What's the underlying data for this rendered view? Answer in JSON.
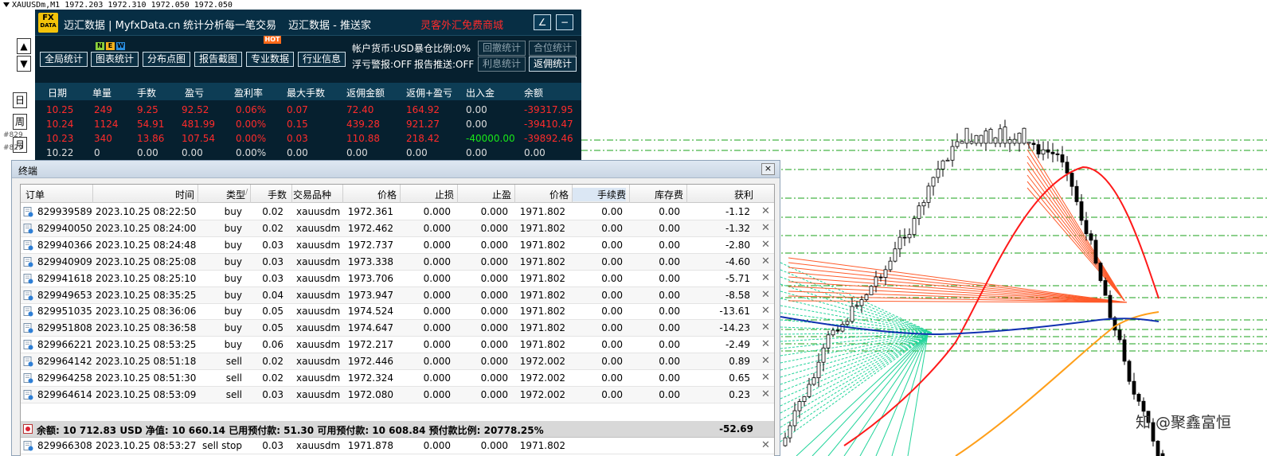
{
  "chart": {
    "header": "XAUUSDm,M1  1972.203 1972.310 1972.050 1972.050",
    "price_labels": [
      "#829",
      "#829"
    ],
    "colors": {
      "up_candle": "#ffffff",
      "down_candle": "#000000",
      "ma_red": "#ff1a1a",
      "ma_orange": "#ff9f1a",
      "ma_blue": "#1030b0",
      "levels_green": "#18a018",
      "fan_green": "#22d49a",
      "fan_red": "#ff5a2a"
    }
  },
  "stats": {
    "logo_top": "FX",
    "logo_bottom": "DATA",
    "title_site": "迈汇数据 | MyfxData.cn",
    "title_mode": "统计分析每一笔交易",
    "title_push": "迈汇数据 - 推送家",
    "title_promo": "灵客外汇免费商城",
    "btn_draw_icon": "∠",
    "btn_min_icon": "−",
    "buttons": [
      "全局统计",
      "图表统计",
      "分布点图",
      "报告截图",
      "专业数据",
      "行业信息"
    ],
    "tags": {
      "n": "N",
      "e": "E",
      "w": "W",
      "hot": "HOT"
    },
    "info": {
      "currency": "帐户货币:USD",
      "exposure": "暴仓比例:0%",
      "float_alert": "浮亏警报:OFF",
      "report_push": "报告推送:OFF"
    },
    "right_buttons": [
      "回撤统计",
      "合位统计",
      "利息统计",
      "返佣统计"
    ],
    "nav": {
      "up": "▲",
      "down": "▼"
    },
    "period_tabs": [
      "日",
      "周",
      "月"
    ],
    "columns": [
      "日期",
      "单量",
      "手数",
      "盈亏",
      "盈利率",
      "最大手数",
      "返佣金额",
      "返佣+盈亏",
      "出入金",
      "余额"
    ],
    "rows": [
      {
        "date": "10.25",
        "count": "249",
        "lots": "9.25",
        "pl": "92.52",
        "rate": "0.06%",
        "maxlots": "0.07",
        "rebate": "72.40",
        "rebate_pl": "164.92",
        "io": "0.00",
        "balance": "-39317.95",
        "color": "r"
      },
      {
        "date": "10.24",
        "count": "1124",
        "lots": "54.91",
        "pl": "481.99",
        "rate": "0.00%",
        "maxlots": "0.15",
        "rebate": "439.28",
        "rebate_pl": "921.27",
        "io": "0.00",
        "balance": "-39410.47",
        "color": "r"
      },
      {
        "date": "10.23",
        "count": "340",
        "lots": "13.86",
        "pl": "107.54",
        "rate": "0.00%",
        "maxlots": "0.03",
        "rebate": "110.88",
        "rebate_pl": "218.42",
        "io": "-40000.00",
        "balance": "-39892.46",
        "color": "r"
      },
      {
        "date": "10.22",
        "count": "0",
        "lots": "0.00",
        "pl": "0.00",
        "rate": "0.00%",
        "maxlots": "0.00",
        "rebate": "0.00",
        "rebate_pl": "0.00",
        "io": "0.00",
        "balance": "0.00",
        "color": "w"
      }
    ]
  },
  "terminal": {
    "title": "终端",
    "close": "×",
    "columns": [
      "订单",
      "时间",
      "类型",
      "手数",
      "交易品种",
      "价格",
      "止损",
      "止盈",
      "价格",
      "手续费",
      "库存费",
      "获利"
    ],
    "sort_mark": "/",
    "orders": [
      {
        "id": "829939589",
        "time": "2023.10.25 08:22:50",
        "type": "buy",
        "lots": "0.02",
        "symbol": "xauusdm",
        "price": "1972.361",
        "sl": "0.000",
        "tp": "0.000",
        "cur": "1971.802",
        "fee": "0.00",
        "swap": "0.00",
        "profit": "-1.12"
      },
      {
        "id": "829940050",
        "time": "2023.10.25 08:24:00",
        "type": "buy",
        "lots": "0.02",
        "symbol": "xauusdm",
        "price": "1972.462",
        "sl": "0.000",
        "tp": "0.000",
        "cur": "1971.802",
        "fee": "0.00",
        "swap": "0.00",
        "profit": "-1.32"
      },
      {
        "id": "829940366",
        "time": "2023.10.25 08:24:48",
        "type": "buy",
        "lots": "0.03",
        "symbol": "xauusdm",
        "price": "1972.737",
        "sl": "0.000",
        "tp": "0.000",
        "cur": "1971.802",
        "fee": "0.00",
        "swap": "0.00",
        "profit": "-2.80"
      },
      {
        "id": "829940909",
        "time": "2023.10.25 08:25:08",
        "type": "buy",
        "lots": "0.03",
        "symbol": "xauusdm",
        "price": "1973.338",
        "sl": "0.000",
        "tp": "0.000",
        "cur": "1971.802",
        "fee": "0.00",
        "swap": "0.00",
        "profit": "-4.60"
      },
      {
        "id": "829941618",
        "time": "2023.10.25 08:25:10",
        "type": "buy",
        "lots": "0.03",
        "symbol": "xauusdm",
        "price": "1973.706",
        "sl": "0.000",
        "tp": "0.000",
        "cur": "1971.802",
        "fee": "0.00",
        "swap": "0.00",
        "profit": "-5.71"
      },
      {
        "id": "829949653",
        "time": "2023.10.25 08:35:25",
        "type": "buy",
        "lots": "0.04",
        "symbol": "xauusdm",
        "price": "1973.947",
        "sl": "0.000",
        "tp": "0.000",
        "cur": "1971.802",
        "fee": "0.00",
        "swap": "0.00",
        "profit": "-8.58"
      },
      {
        "id": "829951035",
        "time": "2023.10.25 08:36:06",
        "type": "buy",
        "lots": "0.05",
        "symbol": "xauusdm",
        "price": "1974.524",
        "sl": "0.000",
        "tp": "0.000",
        "cur": "1971.802",
        "fee": "0.00",
        "swap": "0.00",
        "profit": "-13.61"
      },
      {
        "id": "829951808",
        "time": "2023.10.25 08:36:58",
        "type": "buy",
        "lots": "0.05",
        "symbol": "xauusdm",
        "price": "1974.647",
        "sl": "0.000",
        "tp": "0.000",
        "cur": "1971.802",
        "fee": "0.00",
        "swap": "0.00",
        "profit": "-14.23"
      },
      {
        "id": "829966221",
        "time": "2023.10.25 08:53:25",
        "type": "buy",
        "lots": "0.06",
        "symbol": "xauusdm",
        "price": "1972.217",
        "sl": "0.000",
        "tp": "0.000",
        "cur": "1971.802",
        "fee": "0.00",
        "swap": "0.00",
        "profit": "-2.49"
      },
      {
        "id": "829964142",
        "time": "2023.10.25 08:51:18",
        "type": "sell",
        "lots": "0.02",
        "symbol": "xauusdm",
        "price": "1972.446",
        "sl": "0.000",
        "tp": "0.000",
        "cur": "1972.002",
        "fee": "0.00",
        "swap": "0.00",
        "profit": "0.89"
      },
      {
        "id": "829964258",
        "time": "2023.10.25 08:51:30",
        "type": "sell",
        "lots": "0.02",
        "symbol": "xauusdm",
        "price": "1972.324",
        "sl": "0.000",
        "tp": "0.000",
        "cur": "1972.002",
        "fee": "0.00",
        "swap": "0.00",
        "profit": "0.65"
      },
      {
        "id": "829964614",
        "time": "2023.10.25 08:53:09",
        "type": "sell",
        "lots": "0.03",
        "symbol": "xauusdm",
        "price": "1972.080",
        "sl": "0.000",
        "tp": "0.000",
        "cur": "1972.002",
        "fee": "0.00",
        "swap": "0.00",
        "profit": "0.23"
      }
    ],
    "summary": {
      "text": "余额: 10 712.83 USD  净值: 10 660.14  已用预付款: 51.30  可用预付款: 10 608.84  预付款比例: 20778.25%",
      "total": "-52.69"
    },
    "pending": {
      "id": "829966308",
      "time": "2023.10.25 08:53:27",
      "type": "sell stop",
      "lots": "0.03",
      "symbol": "xauusdm",
      "price": "1971.878",
      "sl": "0.000",
      "tp": "0.000",
      "cur": "1971.802",
      "fee": "",
      "swap": "",
      "profit": ""
    }
  },
  "watermark": "知 @聚鑫富恒"
}
